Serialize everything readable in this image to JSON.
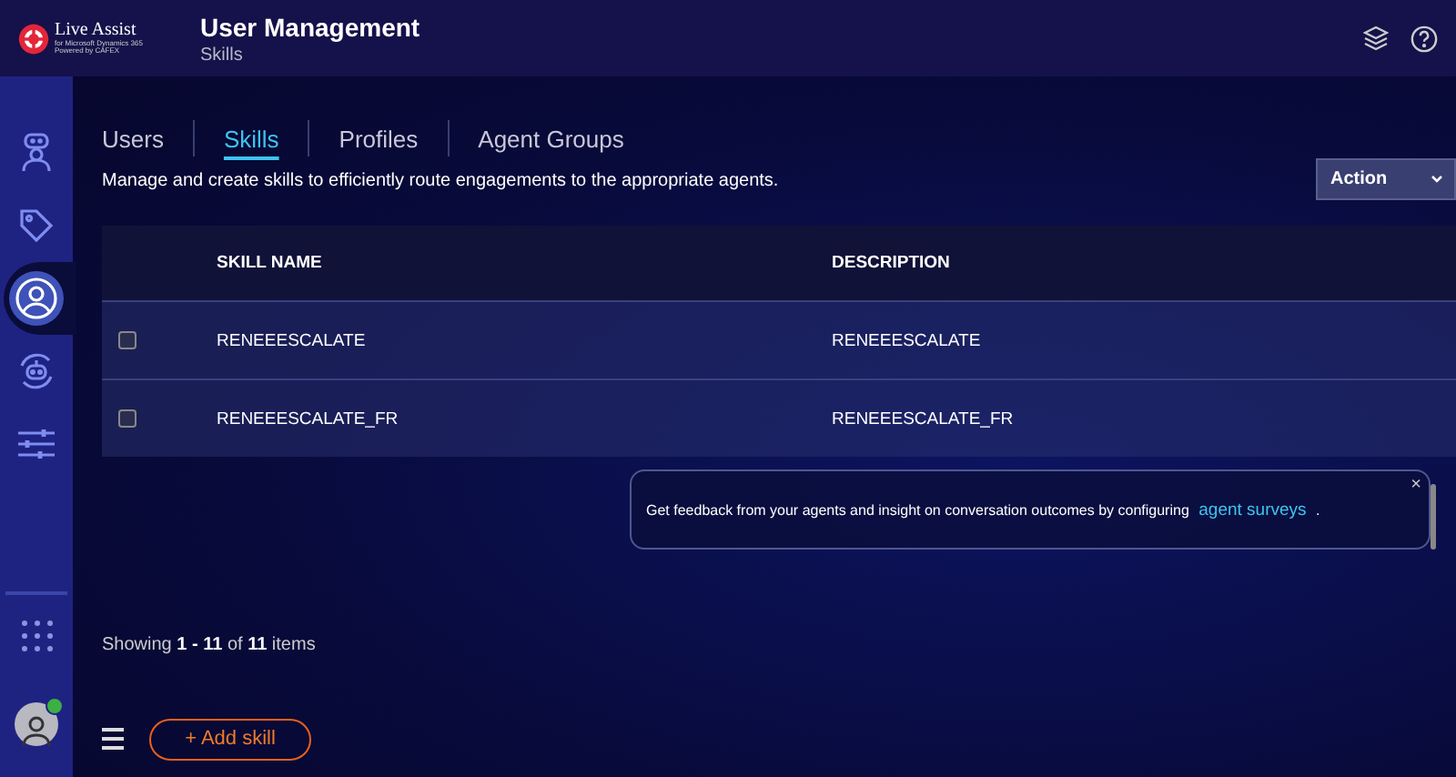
{
  "brand": {
    "name": "Live Assist",
    "line_1": "for Microsoft Dynamics 365",
    "line_2": "Powered by CAFEX"
  },
  "header": {
    "title": "User Management",
    "subtitle": "Skills"
  },
  "sidebar": {
    "items": [
      {
        "kind": "agent",
        "selected": false
      },
      {
        "kind": "tag",
        "selected": false
      },
      {
        "kind": "user",
        "selected": true
      },
      {
        "kind": "bot",
        "selected": false
      },
      {
        "kind": "sliders",
        "selected": false
      }
    ],
    "presence_online": true
  },
  "tabs": [
    {
      "label": "Users",
      "selected": false
    },
    {
      "label": "Skills",
      "selected": true
    },
    {
      "label": "Profiles",
      "selected": false
    },
    {
      "label": "Agent Groups",
      "selected": false
    }
  ],
  "description": "Manage and create skills to efficiently route engagements to the appropriate agents.",
  "action_dropdown": {
    "label": "Action"
  },
  "table": {
    "columns": [
      "SKILL NAME",
      "DESCRIPTION"
    ],
    "rows": [
      {
        "name": "RENEEESCALATE",
        "description": "RENEEESCALATE",
        "checked": false
      },
      {
        "name": "RENEEESCALATE_FR",
        "description": "RENEEESCALATE_FR",
        "checked": false
      }
    ]
  },
  "toast": {
    "text": "Get feedback from your agents and insight on conversation outcomes by configuring",
    "link": "agent surveys",
    "end": ".",
    "close": "×"
  },
  "pagination": "Showing **1 - 11** of **11** items",
  "add_button": {
    "label": "+ Add skill"
  }
}
